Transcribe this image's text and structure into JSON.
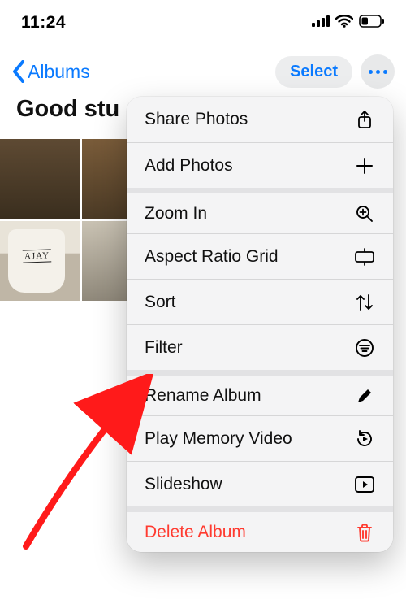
{
  "status": {
    "time": "11:24"
  },
  "nav": {
    "back_label": "Albums",
    "select_label": "Select"
  },
  "album": {
    "title": "Good stu"
  },
  "thumbs": {
    "cup_text": "AJAY"
  },
  "menu": {
    "share": "Share Photos",
    "add": "Add Photos",
    "zoom": "Zoom In",
    "aspect": "Aspect Ratio Grid",
    "sort": "Sort",
    "filter": "Filter",
    "rename": "Rename Album",
    "memory": "Play Memory Video",
    "slideshow": "Slideshow",
    "delete": "Delete Album"
  },
  "colors": {
    "accent": "#0a7aff",
    "destructive": "#ff3b30"
  }
}
